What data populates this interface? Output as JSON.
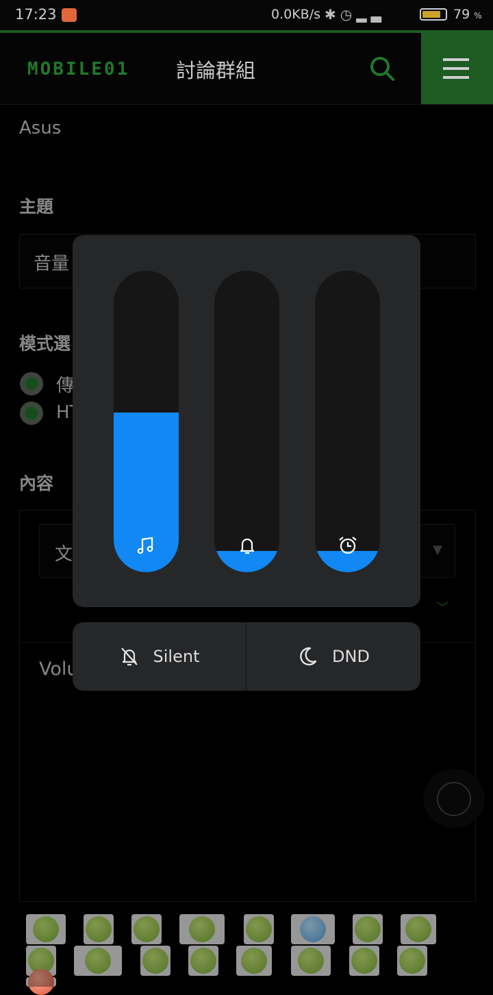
{
  "status_bar": {
    "time": "17:23",
    "network_speed": "0.0KB/s",
    "battery_percent": "79",
    "battery_unit": "%",
    "battery_level": 0.79
  },
  "header": {
    "logo": "MOBILE01",
    "title": "討論群組"
  },
  "form": {
    "brand": "Asus",
    "subject_label": "主題",
    "subject_value_partial": "音量",
    "mode_label_partial": "模式選",
    "mode_options_partial": [
      "傳",
      "HT"
    ],
    "content_label": "內容",
    "text_dropdown_partial": "文",
    "body_text_partial": "Volu"
  },
  "volume_panel": {
    "sliders": [
      {
        "name": "media",
        "icon": "music-note-icon",
        "level": 0.53
      },
      {
        "name": "ringer",
        "icon": "bell-icon",
        "level": 0.07
      },
      {
        "name": "alarm",
        "icon": "alarm-clock-icon",
        "level": 0.07
      }
    ],
    "accent": "#1188f3",
    "modes": [
      {
        "label": "Silent",
        "icon": "bell-off-icon"
      },
      {
        "label": "DND",
        "icon": "moon-icon"
      }
    ]
  }
}
